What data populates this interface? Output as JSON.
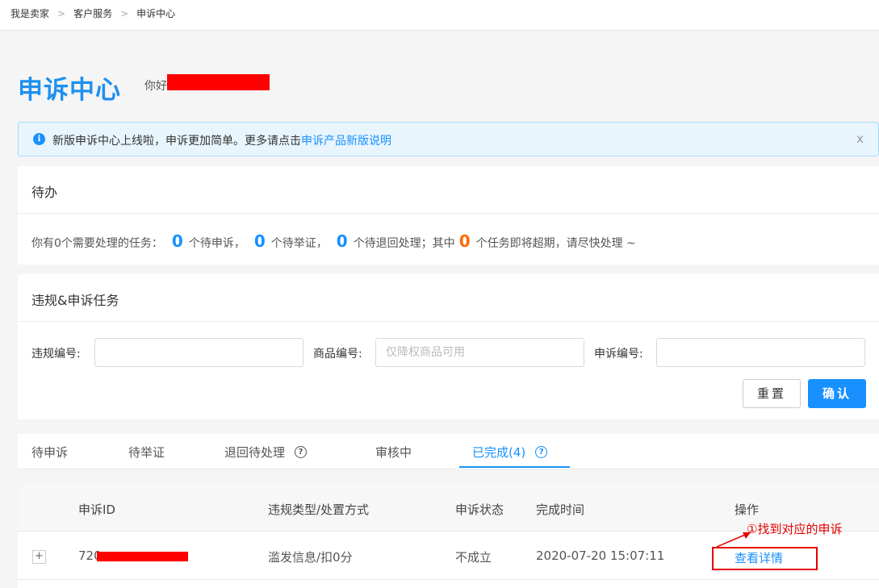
{
  "breadcrumb": [
    "我是卖家",
    "客户服务",
    "申诉中心"
  ],
  "breadcrumb_separator": ">",
  "header": {
    "title": "申诉中心",
    "greeting": "你好"
  },
  "notice": {
    "icon": "info-icon",
    "message": "新版申诉中心上线啦，申诉更加简单。更多请点击",
    "link": "申诉产品新版说明",
    "close": "x"
  },
  "todo": {
    "title": "待办",
    "prefix": "你有0个需要处理的任务：",
    "count1": "0",
    "label1": "个待申诉，",
    "count2": "0",
    "label2": "个待举证，",
    "count3": "0",
    "label3": "个待退回处理；其中",
    "count4": "0",
    "label4": "个任务即将超期，请尽快处理 ~"
  },
  "violations": {
    "title": "违规&申诉任务",
    "violation_no_label": "违规编号:",
    "violation_no_value": "",
    "product_no_label": "商品编号:",
    "product_no_placeholder": "仅降权商品可用",
    "appeal_no_label": "申诉编号:",
    "appeal_no_value": "",
    "reset": "重置",
    "confirm": "确认"
  },
  "tabs": [
    {
      "label": "待申诉"
    },
    {
      "label": "待举证"
    },
    {
      "label": "退回待处理"
    },
    {
      "label": "审核中"
    },
    {
      "label": "已完成(4)"
    }
  ],
  "table": {
    "headers": [
      "申诉ID",
      "违规类型/处置方式",
      "申诉状态",
      "完成时间",
      "操作"
    ],
    "rows": [
      {
        "expand": "+",
        "id_prefix": "720",
        "type": "滥发信息/扣0分",
        "status": "不成立",
        "time": "2020-07-20 15:07:11",
        "action": "查看详情"
      }
    ]
  },
  "annotation": "①找到对应的申诉",
  "colors": {
    "primary": "#1890ff",
    "title_blue": "#1e90ef",
    "orange": "#ff6a00",
    "annotation_red": "#e60000"
  }
}
